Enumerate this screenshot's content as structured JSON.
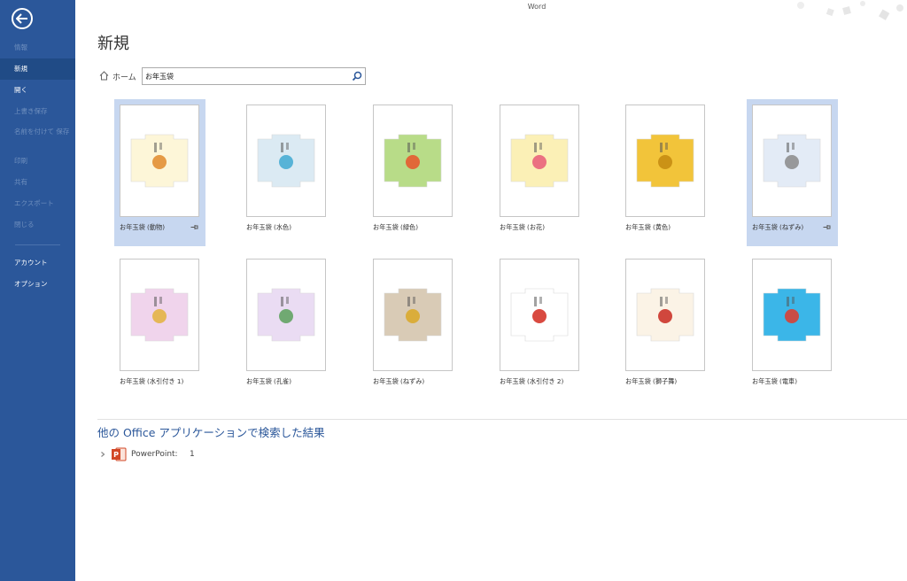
{
  "window": {
    "title": "Word"
  },
  "sidebar": {
    "items": [
      {
        "label": "情報",
        "state": "disabled"
      },
      {
        "label": "新規",
        "state": "active"
      },
      {
        "label": "開く",
        "state": "normal"
      },
      {
        "label": "上書き保存",
        "state": "disabled"
      },
      {
        "label": "名前を付けて 保存",
        "state": "disabled"
      },
      {
        "label": "印刷",
        "state": "disabled"
      },
      {
        "label": "共有",
        "state": "disabled"
      },
      {
        "label": "エクスポート",
        "state": "disabled"
      },
      {
        "label": "閉じる",
        "state": "disabled"
      },
      {
        "label": "アカウント",
        "state": "normal"
      },
      {
        "label": "オプション",
        "state": "normal"
      }
    ]
  },
  "main": {
    "title": "新規",
    "home_label": "ホーム",
    "search": {
      "value": "お年玉袋",
      "placeholder": ""
    },
    "templates": [
      {
        "label": "お年玉袋 (動物)",
        "bg": "#fdf6d8",
        "accent": "#e08a2c",
        "selected": true,
        "pinned": true
      },
      {
        "label": "お年玉袋 (水色)",
        "bg": "#dbeaf3",
        "accent": "#3fa9d1",
        "selected": false,
        "pinned": false
      },
      {
        "label": "お年玉袋 (緑色)",
        "bg": "#b8dc88",
        "accent": "#e8542a",
        "selected": false,
        "pinned": false
      },
      {
        "label": "お年玉袋 (お花)",
        "bg": "#fbf0b6",
        "accent": "#e85b78",
        "selected": false,
        "pinned": false
      },
      {
        "label": "お年玉袋 (黄色)",
        "bg": "#f2c43a",
        "accent": "#c48a10",
        "selected": false,
        "pinned": false
      },
      {
        "label": "お年玉袋 (ねずみ)",
        "bg": "#e3ebf6",
        "accent": "#8a8a8a",
        "selected": true,
        "pinned": true
      },
      {
        "label": "お年玉袋 (水引付き 1)",
        "bg": "#f0d4ec",
        "accent": "#e3b23c",
        "selected": false,
        "pinned": false
      },
      {
        "label": "お年玉袋 (孔雀)",
        "bg": "#eadcf3",
        "accent": "#5aa05a",
        "selected": false,
        "pinned": false
      },
      {
        "label": "お年玉袋 (ねずみ)",
        "bg": "#d9cbb6",
        "accent": "#d9a826",
        "selected": false,
        "pinned": false
      },
      {
        "label": "お年玉袋 (水引付き 2)",
        "bg": "#ffffff",
        "accent": "#d22a1e",
        "selected": false,
        "pinned": false
      },
      {
        "label": "お年玉袋 (獅子舞)",
        "bg": "#fbf3e6",
        "accent": "#c8281e",
        "selected": false,
        "pinned": false
      },
      {
        "label": "お年玉袋 (電車)",
        "bg": "#3bb6e8",
        "accent": "#e23a2a",
        "selected": false,
        "pinned": false
      }
    ],
    "other_heading": "他の Office アプリケーションで検索した結果",
    "other_results": [
      {
        "app": "PowerPoint:",
        "count": "1",
        "icon": "powerpoint-icon",
        "color": "#d24726"
      }
    ]
  },
  "colors": {
    "sidebar": "#2b579a",
    "selected": "#c7d7f0",
    "link": "#2b579a"
  }
}
